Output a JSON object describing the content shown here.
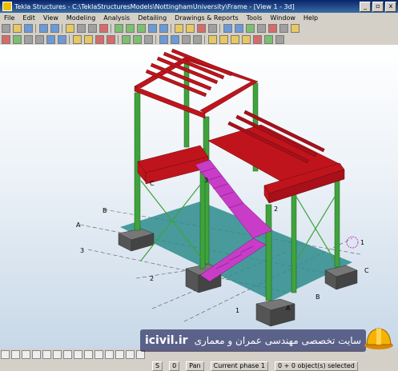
{
  "window": {
    "title": "Tekla Structures - C:\\TeklaStructuresModels\\NottinghamUniversity\\Frame - [View 1 - 3d]",
    "minimize": "_",
    "restore": "▫",
    "close": "x"
  },
  "menu": [
    "File",
    "Edit",
    "View",
    "Modeling",
    "Analysis",
    "Detailing",
    "Drawings & Reports",
    "Tools",
    "Window",
    "Help"
  ],
  "grid_labels": {
    "a_left": "A",
    "b_left": "B",
    "c_left": "C",
    "three_left": "3",
    "two_left": "2",
    "one_bottom": "1",
    "a_bottom": "A",
    "b_right": "B",
    "c_right": "C",
    "one_right": "1",
    "two_mid": "2",
    "three_mid": "3"
  },
  "status": {
    "s": "S",
    "zero": "0",
    "mode": "Pan",
    "phase": "Current phase 1",
    "selection": "0 + 0 object(s) selected"
  },
  "watermark": {
    "site": "icivil.ir",
    "text": "سایت تخصصی مهندسی عمران و معماری"
  },
  "colors": {
    "beam": "#c0141c",
    "column": "#3fa33c",
    "stair": "#c83cc8",
    "slab": "#2e8c8c",
    "footing": "#555555"
  }
}
